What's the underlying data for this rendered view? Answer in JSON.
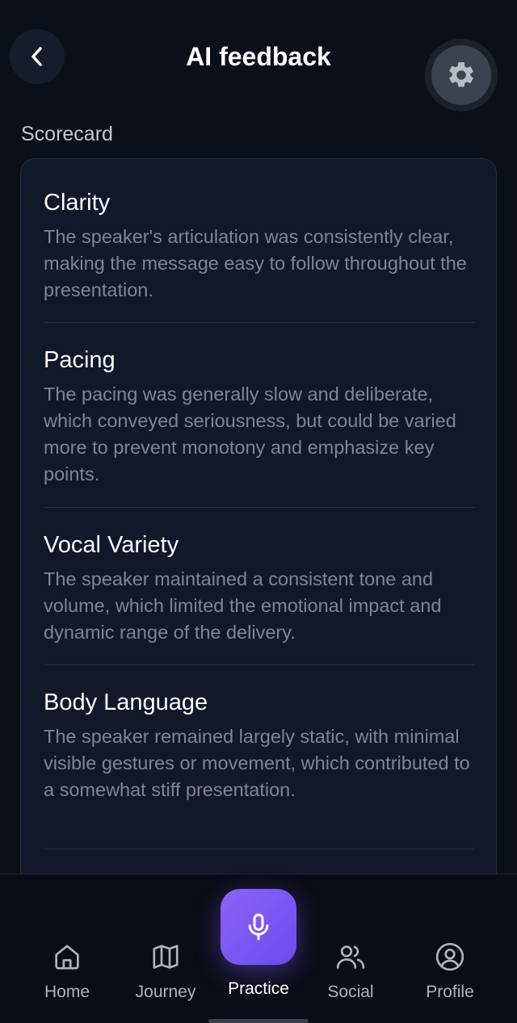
{
  "header": {
    "title": "AI feedback",
    "back_icon": "chevron-left-icon",
    "settings_icon": "gear-icon"
  },
  "scorecard": {
    "label": "Scorecard",
    "items": [
      {
        "title": "Clarity",
        "description": "The speaker's articulation was consistently clear, making the message easy to follow throughout the presentation."
      },
      {
        "title": "Pacing",
        "description": "The pacing was generally slow and deliberate, which conveyed seriousness, but could be varied more to prevent monotony and emphasize key points."
      },
      {
        "title": "Vocal Variety",
        "description": "The speaker maintained a consistent tone and volume, which limited the emotional impact and dynamic range of the delivery."
      },
      {
        "title": "Body Language",
        "description": "The speaker remained largely static, with minimal visible gestures or movement, which contributed to a somewhat stiff presentation."
      }
    ]
  },
  "nav": {
    "home": {
      "label": "Home",
      "icon": "home-icon"
    },
    "journey": {
      "label": "Journey",
      "icon": "map-icon"
    },
    "practice": {
      "label": "Practice",
      "icon": "microphone-icon"
    },
    "social": {
      "label": "Social",
      "icon": "users-icon"
    },
    "profile": {
      "label": "Profile",
      "icon": "user-circle-icon"
    }
  },
  "colors": {
    "background": "#0b0f1a",
    "card": "#111829",
    "accent": "#7c5cf5",
    "muted_text": "#7f8596"
  }
}
